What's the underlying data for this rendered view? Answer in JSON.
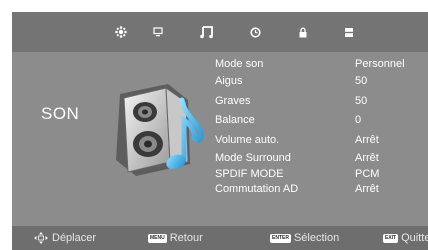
{
  "tabs": [
    {
      "icon": "image-settings-icon"
    },
    {
      "icon": "monitor-icon"
    },
    {
      "icon": "music-note-icon",
      "active": true
    },
    {
      "icon": "clock-icon"
    },
    {
      "icon": "lock-icon"
    },
    {
      "icon": "options-icon"
    }
  ],
  "section": {
    "title": "SON",
    "art_icon": "speaker-music-icon"
  },
  "menu": [
    {
      "label": "Mode son",
      "value": "Personnel"
    },
    {
      "label": "Aigus",
      "value": "50"
    },
    {
      "label": "Graves",
      "value": "50"
    },
    {
      "label": "Balance",
      "value": "0"
    },
    {
      "label": "Volume auto.",
      "value": "Arrêt"
    },
    {
      "label": "Mode Surround",
      "value": "Arrêt"
    },
    {
      "label": "SPDIF MODE",
      "value": "PCM"
    },
    {
      "label": "Commutation AD",
      "value": "Arrêt"
    }
  ],
  "footer": {
    "move": {
      "icon": "dpad-icon",
      "label": "Déplacer"
    },
    "back": {
      "key": "MENU",
      "label": "Retour"
    },
    "select": {
      "key": "ENTER",
      "label": "Sélection"
    },
    "exit": {
      "key": "EXIT",
      "label": "Quitter"
    }
  },
  "colors": {
    "panel": "#8c8c8c",
    "topbar": "#747474",
    "footer": "#6e6e6e",
    "accent_blue": "#3fb3ea"
  }
}
